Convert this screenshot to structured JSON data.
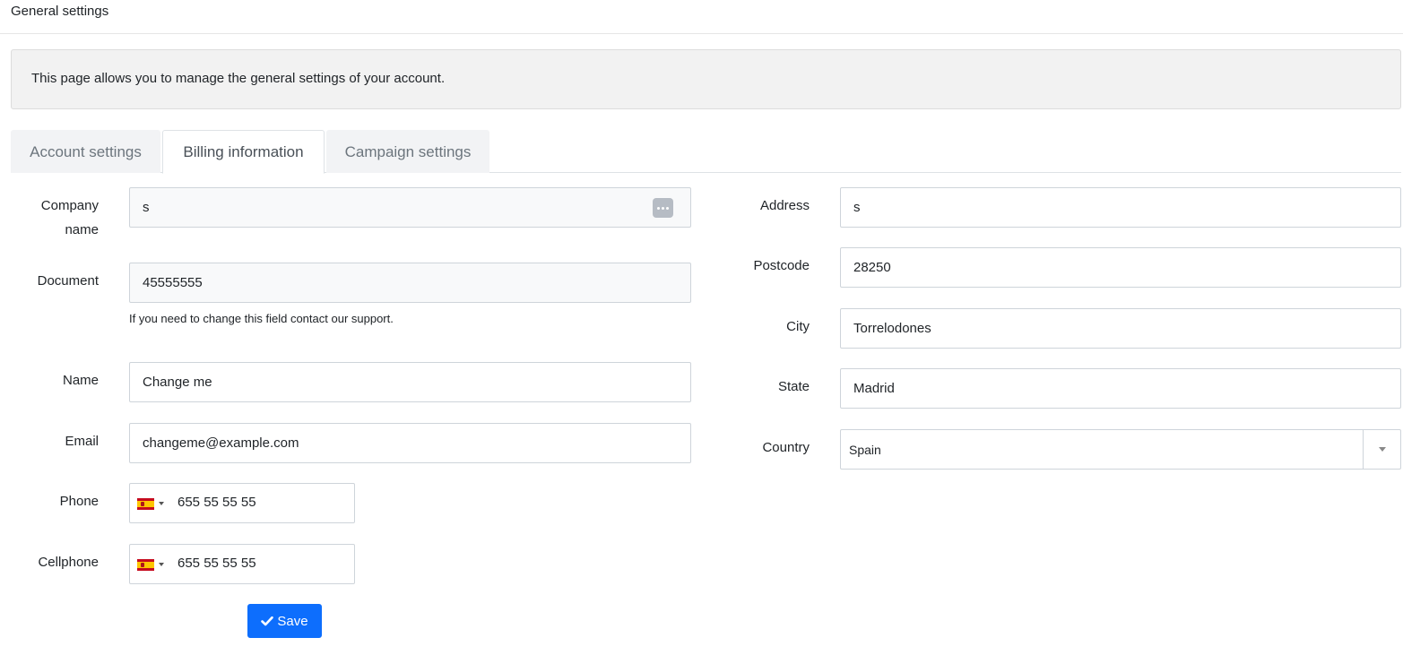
{
  "header": {
    "title": "General settings"
  },
  "info": {
    "text": "This page allows you to manage the general settings of your account."
  },
  "tabs": [
    {
      "label": "Account settings",
      "active": false
    },
    {
      "label": "Billing information",
      "active": true
    },
    {
      "label": "Campaign settings",
      "active": false
    }
  ],
  "form_left": {
    "company_name": {
      "label_line1": "Company",
      "label_line2": "name",
      "value": "s",
      "icon": "more-dots-icon"
    },
    "document": {
      "label": "Document",
      "value": "45555555",
      "help": "If you need to change this field contact our support."
    },
    "name": {
      "label": "Name",
      "value": "Change me"
    },
    "email": {
      "label": "Email",
      "value": "changeme@example.com"
    },
    "phone": {
      "label": "Phone",
      "value": "655 55 55 55",
      "country_flag": "spain-flag-icon"
    },
    "cellphone": {
      "label": "Cellphone",
      "value": "655 55 55 55",
      "country_flag": "spain-flag-icon"
    }
  },
  "form_right": {
    "address": {
      "label": "Address",
      "value": "s"
    },
    "postcode": {
      "label": "Postcode",
      "value": "28250"
    },
    "city": {
      "label": "City",
      "value": "Torrelodones"
    },
    "state": {
      "label": "State",
      "value": "Madrid"
    },
    "country": {
      "label": "Country",
      "value": "Spain"
    }
  },
  "actions": {
    "save_label": "Save",
    "save_icon": "check-icon"
  },
  "colors": {
    "primary": "#0d6efd",
    "info_background": "#f2f2f2",
    "readonly_background": "#f8f9fa",
    "tab_inactive_background": "#f2f3f5"
  }
}
